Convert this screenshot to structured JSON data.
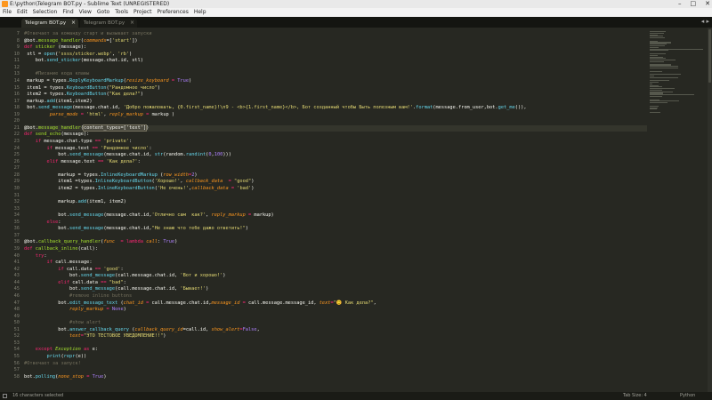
{
  "window": {
    "title": "E:\\python\\Telegram BOT.py - Sublime Text (UNREGISTERED)",
    "controls": [
      "–",
      "□",
      "✕"
    ]
  },
  "menu": [
    "File",
    "Edit",
    "Selection",
    "Find",
    "View",
    "Goto",
    "Tools",
    "Project",
    "Preferences",
    "Help"
  ],
  "tabs": [
    {
      "label": "Telegram BOT.py",
      "active": true
    },
    {
      "label": "Telegram BOT.py",
      "active": false
    }
  ],
  "tab_scroll_arrows": "◂ ▸",
  "gutter": [
    "7",
    "8",
    "9",
    "10",
    "11",
    "12",
    "13",
    "14",
    "15",
    "16",
    "17",
    "18",
    "19",
    "20",
    "21",
    "22",
    "23",
    "24",
    "25",
    "26",
    "27",
    "28",
    "29",
    "30",
    "31",
    "32",
    "33",
    "34",
    "35",
    "36",
    "37",
    "38",
    "39",
    "40",
    "41",
    "42",
    "43",
    "44",
    "45",
    "46",
    "47",
    "48",
    "49",
    "50",
    "51",
    "52",
    "53",
    "54",
    "55",
    "56",
    "57",
    "58"
  ],
  "code_lines": [
    [
      {
        "t": "#Отвечает за команду старт и вызывает запуски",
        "c": "com"
      }
    ],
    [
      {
        "t": "@bot.",
        "c": "pl"
      },
      {
        "t": "message_handler",
        "c": "dec"
      },
      {
        "t": "(",
        "c": "pl"
      },
      {
        "t": "commands",
        "c": "arg"
      },
      {
        "t": "=[",
        "c": "pl"
      },
      {
        "t": "'start'",
        "c": "str"
      },
      {
        "t": "])",
        "c": "pl"
      }
    ],
    [
      {
        "t": "def ",
        "c": "kw"
      },
      {
        "t": "sticker",
        "c": "dec"
      },
      {
        "t": " (message):",
        "c": "pl"
      }
    ],
    [
      {
        "t": " stl = ",
        "c": "pl"
      },
      {
        "t": "open",
        "c": "fn"
      },
      {
        "t": "(",
        "c": "pl"
      },
      {
        "t": "'ssss/sticker.webp'",
        "c": "str"
      },
      {
        "t": ", ",
        "c": "pl"
      },
      {
        "t": "'rb'",
        "c": "str"
      },
      {
        "t": ")",
        "c": "pl"
      }
    ],
    [
      {
        "t": "    bot.",
        "c": "pl"
      },
      {
        "t": "send_sticker",
        "c": "fn"
      },
      {
        "t": "(message.chat.id, stl)",
        "c": "pl"
      }
    ],
    [],
    [
      {
        "t": "    #Писание кода клавы",
        "c": "com"
      }
    ],
    [
      {
        "t": " markup = types.",
        "c": "pl"
      },
      {
        "t": "ReplyKeyboardMarkup",
        "c": "fn"
      },
      {
        "t": "(",
        "c": "pl"
      },
      {
        "t": "resize_keyboard",
        "c": "arg"
      },
      {
        "t": " = ",
        "c": "kw"
      },
      {
        "t": "True",
        "c": "num"
      },
      {
        "t": ")",
        "c": "pl"
      }
    ],
    [
      {
        "t": " item1 = types.",
        "c": "pl"
      },
      {
        "t": "KeyboardButton",
        "c": "fn"
      },
      {
        "t": "(",
        "c": "pl"
      },
      {
        "t": "\"Рандомное число\"",
        "c": "str"
      },
      {
        "t": ")",
        "c": "pl"
      }
    ],
    [
      {
        "t": " item2 = types.",
        "c": "pl"
      },
      {
        "t": "KeyboardButton",
        "c": "fn"
      },
      {
        "t": "(",
        "c": "pl"
      },
      {
        "t": "\"Как дела?\"",
        "c": "str"
      },
      {
        "t": ")",
        "c": "pl"
      }
    ],
    [
      {
        "t": " markup.",
        "c": "pl"
      },
      {
        "t": "add",
        "c": "fn"
      },
      {
        "t": "(item1,item2)",
        "c": "pl"
      }
    ],
    [
      {
        "t": " bot.",
        "c": "pl"
      },
      {
        "t": "send_message",
        "c": "fn"
      },
      {
        "t": "(message.chat.id, ",
        "c": "pl"
      },
      {
        "t": "'Добро пожаловать, {0.first_name}!\\n9 - <b>{1.first_name}</b>, Бот созданный чтобы Быть полезным вам!'",
        "c": "str"
      },
      {
        "t": ".",
        "c": "pl"
      },
      {
        "t": "format",
        "c": "fn"
      },
      {
        "t": "(message.from_user,bot.",
        "c": "pl"
      },
      {
        "t": "get_me",
        "c": "fn"
      },
      {
        "t": "()),",
        "c": "pl"
      }
    ],
    [
      {
        "t": "         ",
        "c": "pl"
      },
      {
        "t": "parse_mode",
        "c": "arg"
      },
      {
        "t": " = ",
        "c": "kw"
      },
      {
        "t": "'html'",
        "c": "str"
      },
      {
        "t": ", ",
        "c": "pl"
      },
      {
        "t": "reply_markup",
        "c": "arg"
      },
      {
        "t": " = ",
        "c": "kw"
      },
      {
        "t": "markup )",
        "c": "pl"
      }
    ],
    [],
    [
      {
        "t": "@bot.",
        "c": "pl"
      },
      {
        "t": "message_handler",
        "c": "dec"
      },
      {
        "t": "(",
        "c": "pl"
      },
      {
        "t": "content_types=['text']",
        "c": "sel"
      },
      {
        "t": ")",
        "c": "pl"
      }
    ],
    [
      {
        "t": "def ",
        "c": "kw"
      },
      {
        "t": "send_echo",
        "c": "dec"
      },
      {
        "t": "(message):",
        "c": "pl"
      }
    ],
    [
      {
        "t": "    ",
        "c": "pl"
      },
      {
        "t": "if ",
        "c": "kw"
      },
      {
        "t": "message.chat.type ",
        "c": "pl"
      },
      {
        "t": "== ",
        "c": "kw"
      },
      {
        "t": "'private'",
        "c": "str"
      },
      {
        "t": ":",
        "c": "pl"
      }
    ],
    [
      {
        "t": "        ",
        "c": "pl"
      },
      {
        "t": "if ",
        "c": "kw"
      },
      {
        "t": "message.text ",
        "c": "pl"
      },
      {
        "t": "== ",
        "c": "kw"
      },
      {
        "t": "'Рандомное число'",
        "c": "str"
      },
      {
        "t": ":",
        "c": "pl"
      }
    ],
    [
      {
        "t": "            bot.",
        "c": "pl"
      },
      {
        "t": "send_message",
        "c": "fn"
      },
      {
        "t": "(message.chat.id, ",
        "c": "pl"
      },
      {
        "t": "str",
        "c": "fn"
      },
      {
        "t": "(random.",
        "c": "pl"
      },
      {
        "t": "randint",
        "c": "fn"
      },
      {
        "t": "(",
        "c": "pl"
      },
      {
        "t": "0",
        "c": "num"
      },
      {
        "t": ",",
        "c": "pl"
      },
      {
        "t": "100",
        "c": "num"
      },
      {
        "t": ")))",
        "c": "pl"
      }
    ],
    [
      {
        "t": "        ",
        "c": "pl"
      },
      {
        "t": "elif ",
        "c": "kw"
      },
      {
        "t": "message.text ",
        "c": "pl"
      },
      {
        "t": "== ",
        "c": "kw"
      },
      {
        "t": "'Как дела?'",
        "c": "str"
      },
      {
        "t": ":",
        "c": "pl"
      }
    ],
    [],
    [
      {
        "t": "            markup = types.",
        "c": "pl"
      },
      {
        "t": "InlineKeyboardMarkup",
        "c": "fn"
      },
      {
        "t": " (",
        "c": "pl"
      },
      {
        "t": "row_width",
        "c": "arg"
      },
      {
        "t": "=",
        "c": "kw"
      },
      {
        "t": "2",
        "c": "num"
      },
      {
        "t": ")",
        "c": "pl"
      }
    ],
    [
      {
        "t": "            item1 =types.",
        "c": "pl"
      },
      {
        "t": "InlineKeyboardButton",
        "c": "fn"
      },
      {
        "t": "(",
        "c": "pl"
      },
      {
        "t": "'Хорошо!'",
        "c": "str"
      },
      {
        "t": ", ",
        "c": "pl"
      },
      {
        "t": "callback_data",
        "c": "arg"
      },
      {
        "t": "  = ",
        "c": "kw"
      },
      {
        "t": "\"good\"",
        "c": "str"
      },
      {
        "t": ")",
        "c": "pl"
      }
    ],
    [
      {
        "t": "            item2 = types.",
        "c": "pl"
      },
      {
        "t": "InlineKeyboardButton",
        "c": "fn"
      },
      {
        "t": "(",
        "c": "pl"
      },
      {
        "t": "'Не очень!'",
        "c": "str"
      },
      {
        "t": ",",
        "c": "pl"
      },
      {
        "t": "callback_data",
        "c": "arg"
      },
      {
        "t": " = ",
        "c": "kw"
      },
      {
        "t": "'bad'",
        "c": "str"
      },
      {
        "t": ")",
        "c": "pl"
      }
    ],
    [],
    [
      {
        "t": "            markup.",
        "c": "pl"
      },
      {
        "t": "add",
        "c": "fn"
      },
      {
        "t": "(item1, item2)",
        "c": "pl"
      }
    ],
    [],
    [
      {
        "t": "            bot.",
        "c": "pl"
      },
      {
        "t": "send_message",
        "c": "fn"
      },
      {
        "t": "(message.chat.id,",
        "c": "pl"
      },
      {
        "t": "'Отлично сам  как?'",
        "c": "str"
      },
      {
        "t": ", ",
        "c": "pl"
      },
      {
        "t": "reply_markup",
        "c": "arg"
      },
      {
        "t": " = ",
        "c": "kw"
      },
      {
        "t": "markup)",
        "c": "pl"
      }
    ],
    [
      {
        "t": "        ",
        "c": "pl"
      },
      {
        "t": "else",
        "c": "kw"
      },
      {
        "t": ":",
        "c": "pl"
      }
    ],
    [
      {
        "t": "            bot.",
        "c": "pl"
      },
      {
        "t": "send_message",
        "c": "fn"
      },
      {
        "t": "(message.chat.id,",
        "c": "pl"
      },
      {
        "t": "\"Не знаю что тебе дажо ответить!\"",
        "c": "str"
      },
      {
        "t": ")",
        "c": "pl"
      }
    ],
    [],
    [
      {
        "t": "@bot.",
        "c": "pl"
      },
      {
        "t": "callback_query_handler",
        "c": "dec"
      },
      {
        "t": "(",
        "c": "pl"
      },
      {
        "t": "func",
        "c": "arg"
      },
      {
        "t": "  = ",
        "c": "kw"
      },
      {
        "t": "lambda ",
        "c": "kw"
      },
      {
        "t": "call",
        "c": "arg"
      },
      {
        "t": ": ",
        "c": "pl"
      },
      {
        "t": "True",
        "c": "num"
      },
      {
        "t": ")",
        "c": "pl"
      }
    ],
    [
      {
        "t": "def ",
        "c": "kw"
      },
      {
        "t": "callback_inline",
        "c": "dec"
      },
      {
        "t": "(call):",
        "c": "pl"
      }
    ],
    [
      {
        "t": "    ",
        "c": "pl"
      },
      {
        "t": "try",
        "c": "kw"
      },
      {
        "t": ":",
        "c": "pl"
      }
    ],
    [
      {
        "t": "        ",
        "c": "pl"
      },
      {
        "t": "if ",
        "c": "kw"
      },
      {
        "t": "call.message:",
        "c": "pl"
      }
    ],
    [
      {
        "t": "            ",
        "c": "pl"
      },
      {
        "t": "if ",
        "c": "kw"
      },
      {
        "t": "call.data ",
        "c": "pl"
      },
      {
        "t": "== ",
        "c": "kw"
      },
      {
        "t": "'good'",
        "c": "str"
      },
      {
        "t": ":",
        "c": "pl"
      }
    ],
    [
      {
        "t": "                bot.",
        "c": "pl"
      },
      {
        "t": "send_message",
        "c": "fn"
      },
      {
        "t": "(call.message.chat.id, ",
        "c": "pl"
      },
      {
        "t": "'Вот и хорошо!'",
        "c": "str"
      },
      {
        "t": ")",
        "c": "pl"
      }
    ],
    [
      {
        "t": "            ",
        "c": "pl"
      },
      {
        "t": "elif ",
        "c": "kw"
      },
      {
        "t": "call.data ",
        "c": "pl"
      },
      {
        "t": "== ",
        "c": "kw"
      },
      {
        "t": "\"bad\"",
        "c": "str"
      },
      {
        "t": ":",
        "c": "pl"
      }
    ],
    [
      {
        "t": "                bot.",
        "c": "pl"
      },
      {
        "t": "send_message",
        "c": "fn"
      },
      {
        "t": "(call.message.chat.id, ",
        "c": "pl"
      },
      {
        "t": "'Бывает!'",
        "c": "str"
      },
      {
        "t": ")",
        "c": "pl"
      }
    ],
    [
      {
        "t": "                #remove inline buttons",
        "c": "com"
      }
    ],
    [
      {
        "t": "            bot.",
        "c": "pl"
      },
      {
        "t": "edit_message_text",
        "c": "fn"
      },
      {
        "t": " (",
        "c": "pl"
      },
      {
        "t": "chat_id",
        "c": "arg"
      },
      {
        "t": " = ",
        "c": "kw"
      },
      {
        "t": "call.message.chat.id,",
        "c": "pl"
      },
      {
        "t": "message_id",
        "c": "arg"
      },
      {
        "t": " = ",
        "c": "kw"
      },
      {
        "t": "call.message.message_id, ",
        "c": "pl"
      },
      {
        "t": "text",
        "c": "arg"
      },
      {
        "t": "=",
        "c": "kw"
      },
      {
        "t": "\"😊 Как дела?\"",
        "c": "str"
      },
      {
        "t": ",",
        "c": "pl"
      }
    ],
    [
      {
        "t": "                ",
        "c": "pl"
      },
      {
        "t": "reply_markup",
        "c": "arg"
      },
      {
        "t": " = ",
        "c": "kw"
      },
      {
        "t": "None",
        "c": "num"
      },
      {
        "t": ")",
        "c": "pl"
      }
    ],
    [],
    [
      {
        "t": "                #show alert",
        "c": "com"
      }
    ],
    [
      {
        "t": "            bot.",
        "c": "pl"
      },
      {
        "t": "answer_callback_query",
        "c": "fn"
      },
      {
        "t": " (",
        "c": "pl"
      },
      {
        "t": "callback_query_id",
        "c": "arg"
      },
      {
        "t": "=call.id, ",
        "c": "pl"
      },
      {
        "t": "show_alert",
        "c": "arg"
      },
      {
        "t": "=",
        "c": "kw"
      },
      {
        "t": "False",
        "c": "num"
      },
      {
        "t": ",",
        "c": "pl"
      }
    ],
    [
      {
        "t": "                ",
        "c": "pl"
      },
      {
        "t": "text",
        "c": "arg"
      },
      {
        "t": "=",
        "c": "kw"
      },
      {
        "t": "\"ЭТО ТЕСТОВОЕ УВЕДОМЛЕНИЕ!!\"",
        "c": "str"
      },
      {
        "t": ")",
        "c": "pl"
      }
    ],
    [],
    [
      {
        "t": "    ",
        "c": "pl"
      },
      {
        "t": "except ",
        "c": "kw"
      },
      {
        "t": "Exception ",
        "c": "cls"
      },
      {
        "t": "as ",
        "c": "kw"
      },
      {
        "t": "e:",
        "c": "pl"
      }
    ],
    [
      {
        "t": "        ",
        "c": "pl"
      },
      {
        "t": "print",
        "c": "fn"
      },
      {
        "t": "(",
        "c": "pl"
      },
      {
        "t": "repr",
        "c": "fn"
      },
      {
        "t": "(e))",
        "c": "pl"
      }
    ],
    [
      {
        "t": "#Отвечает за запуск!",
        "c": "com"
      }
    ],
    [],
    [
      {
        "t": "bot.",
        "c": "pl"
      },
      {
        "t": "polling",
        "c": "fn"
      },
      {
        "t": "(",
        "c": "pl"
      },
      {
        "t": "none_stop",
        "c": "arg"
      },
      {
        "t": " = ",
        "c": "kw"
      },
      {
        "t": "True",
        "c": "num"
      },
      {
        "t": ")",
        "c": "pl"
      }
    ]
  ],
  "highlighted_line_index": 14,
  "status": {
    "selection": "16 characters selected",
    "tab_size": "Tab Size: 4",
    "syntax": "Python"
  },
  "colors": {
    "editor_bg": "#272822",
    "keyword": "#f92672",
    "string": "#e6db74",
    "function": "#66d9ef",
    "comment": "#75715e",
    "decorator": "#a6e22e",
    "argument": "#fd971f",
    "constant": "#ae81ff"
  }
}
